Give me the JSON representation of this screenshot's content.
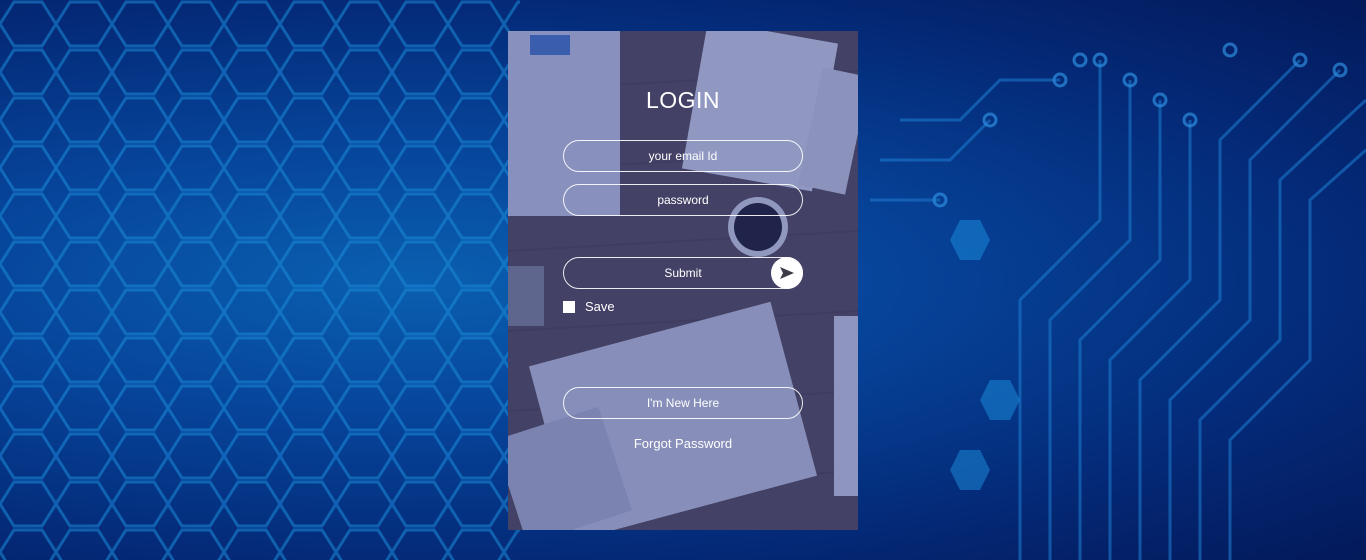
{
  "login": {
    "title": "LOGIN",
    "email_placeholder": "your email Id",
    "password_placeholder": "password",
    "submit_label": "Submit",
    "save_label": "Save",
    "new_here_label": "I'm New Here",
    "forgot_label": "Forgot Password"
  },
  "icons": {
    "submit": "send-icon"
  },
  "colors": {
    "background": "#06449a",
    "accent": "#ffffff",
    "card_overlay": "#3b4a80"
  }
}
